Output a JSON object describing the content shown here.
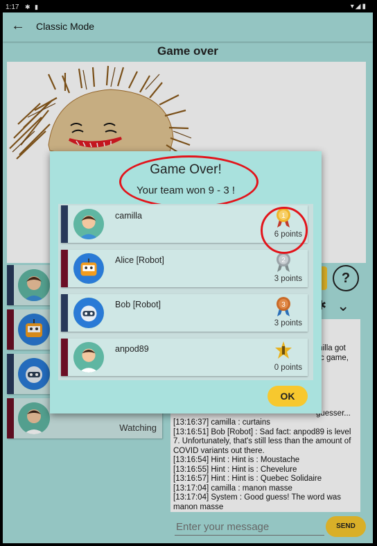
{
  "status_bar": {
    "time": "1:17"
  },
  "toolbar": {
    "title": "Classic Mode"
  },
  "game": {
    "title": "Game over"
  },
  "players": [
    {
      "name": "camilla",
      "status": "",
      "color": "#283a5a"
    },
    {
      "name": "Alice [Robot]",
      "status": "",
      "color": "#6b0f25"
    },
    {
      "name": "Bob [Robot]",
      "status": "",
      "color": "#283a5a"
    },
    {
      "name": "anpod89",
      "status": "Watching",
      "color": "#6b0f25"
    }
  ],
  "side_buttons": {
    "help_label": "?"
  },
  "chat": {
    "lines": [
      "milla got",
      "c game,",
      "[13:16:37] camilla : curtains",
      "[13:16:51] Bob [Robot] : Sad fact: anpod89 is level 7. Unfortunately, that's still less than the amount of COVID variants out there.",
      "[13:16:54] Hint : Hint is : Moustache",
      "[13:16:55] Hint : Hint is : Chevelure",
      "[13:16:57] Hint : Hint is : Quebec Solidaire",
      "[13:17:04] camilla : manon masse",
      "[13:17:04] System : Good guess! The word was manon masse"
    ],
    "partial_line": "guesser...",
    "input_placeholder": "Enter your message",
    "send_label": "SEND"
  },
  "dialog": {
    "title": "Game Over!",
    "subtitle": "Your team won 9 - 3 !",
    "ok_label": "OK",
    "results": [
      {
        "name": "camilla",
        "points": "6 points",
        "medal": "gold-medal",
        "medal_number": "1",
        "color": "#283a5a"
      },
      {
        "name": "Alice [Robot]",
        "points": "3 points",
        "medal": "silver-medal",
        "medal_number": "2",
        "color": "#6b0f25"
      },
      {
        "name": "Bob [Robot]",
        "points": "3 points",
        "medal": "bronze-medal",
        "medal_number": "3",
        "color": "#283a5a"
      },
      {
        "name": "anpod89",
        "points": "0 points",
        "medal": "star-medal",
        "medal_number": "",
        "color": "#6b0f25"
      }
    ]
  },
  "colors": {
    "accent": "#f7c82e",
    "background": "#a9e1dd",
    "annotation": "#e2141b"
  }
}
